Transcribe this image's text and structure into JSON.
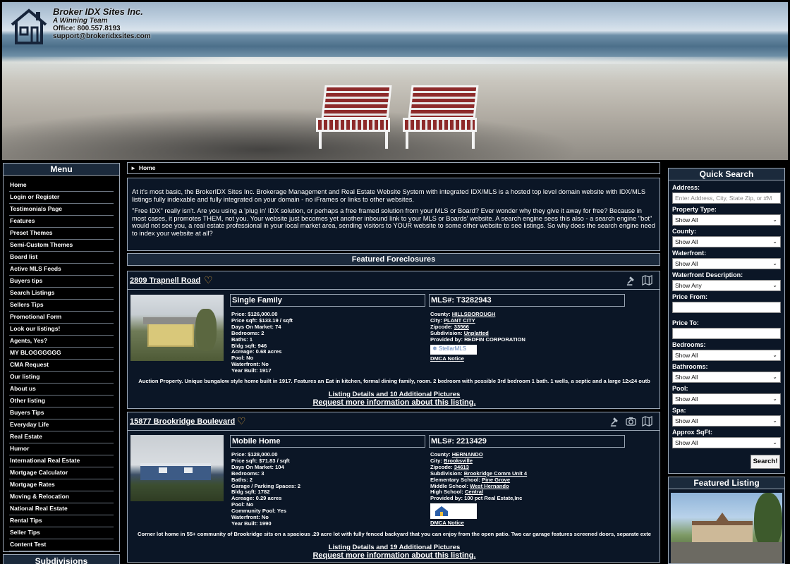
{
  "header": {
    "company_name": "Broker IDX Sites Inc.",
    "tagline": "A Winning Team",
    "office": "Office: 800.557.8193",
    "email": "support@brokeridxsites.com"
  },
  "menu": {
    "title": "Menu",
    "items": [
      "Home",
      "Login or Register",
      "Testimonials Page",
      "Features",
      "Preset Themes",
      "Semi-Custom Themes",
      "Board list",
      "Active MLS Feeds",
      "Buyers tips",
      "Search Listings",
      "Sellers Tips",
      "Promotional Form",
      "Look our listings!",
      "Agents, Yes?",
      "MY BLOGGGGGG",
      "CMA Request",
      "Our listing",
      "About us",
      "Other listing",
      "Buyers Tips",
      "Everyday Life",
      "Real Estate",
      "Humor",
      "International Real Estate",
      "Mortgage Calculator",
      "Mortgage Rates",
      "Moving & Relocation",
      "National Real Estate",
      "Rental Tips",
      "Seller Tips",
      "Content Test"
    ],
    "subdivisions_title": "Subdivisions"
  },
  "breadcrumb": {
    "home": "Home"
  },
  "intro": {
    "p1": "At it's most basic, the BrokerIDX Sites Inc. Brokerage Management and Real Estate Website System with integrated IDX/MLS is a hosted top level domain website with IDX/MLS listings fully indexable and fully integrated on your domain - no iFrames or links to other websites.",
    "p2": "\"Free IDX\" really isn't. Are you using a 'plug in' IDX solution, or perhaps a free framed solution from your MLS or Board? Ever wonder why they give it away for free? Because in most cases, it promotes THEM, not you. Your website just becomes yet another inbound link to your MLS or Boards' website. A search engine sees this also - a search engine \"bot\" would not see you, a real estate professional in your local market area, sending visitors to YOUR website to some other website to see listings. So why does the search engine need to index your website at all?"
  },
  "featured_foreclosures": {
    "title": "Featured Foreclosures"
  },
  "listings": [
    {
      "address": "2809 Trapnell Road",
      "type": "Single Family",
      "mls": "MLS#: T3282943",
      "facts": {
        "price": "Price: $126,000.00",
        "price_sqft": "Price sqft:  $133.19 / sqft",
        "dom": "Days On Market: 74",
        "bedrooms": "Bedrooms: 2",
        "baths": "Baths: 1",
        "bldg_sqft": "Bldg sqft: 946",
        "acreage": "Acreage: 0.68 acres",
        "pool": "Pool: No",
        "waterfront": "Waterfront: No",
        "year_built": "Year Built: 1917"
      },
      "geo": {
        "county_label": "County: ",
        "county": "HILLSBOROUGH",
        "city_label": "City: ",
        "city": "PLANT CITY",
        "zip_label": "Zipcode: ",
        "zip": "33566",
        "subdivision_label": "Subdivision: ",
        "subdivision": "Unplatted",
        "provided_by": "Provided by: REDFIN CORPORATION"
      },
      "mls_logo": "StellarMLS",
      "dmca": "DMCA Notice",
      "description": "Auction Property. Unique bungalow style home built in 1917. Features an Eat in kitchen, formal dining family, room. 2 bedroom with possible 3rd bedroom 1 bath. 1 wells, a septic and a large 12x24 outb",
      "details_link": "Listing Details and 10 Additional Pictures",
      "request_link": "Request more information about this listing."
    },
    {
      "address": "15877 Brookridge Boulevard",
      "type": "Mobile Home",
      "mls": "MLS#: 2213429",
      "facts": {
        "price": "Price: $128,000.00",
        "price_sqft": "Price sqft:  $71.83 / sqft",
        "dom": "Days On Market: 104",
        "bedrooms": "Bedrooms: 3",
        "baths": "Baths: 2",
        "garage": "Garage / Parking Spaces: 2",
        "bldg_sqft": "Bldg sqft: 1782",
        "acreage": "Acreage: 0.29 acres",
        "pool": "Pool: No",
        "community_pool": "Community Pool: Yes",
        "waterfront": "Waterfront: No",
        "year_built": "Year Built: 1990"
      },
      "geo": {
        "county_label": "County: ",
        "county": "HERNANDO",
        "city_label": "City: ",
        "city": "Brooksville",
        "zip_label": "Zipcode: ",
        "zip": "34613",
        "subdivision_label": "Subdivision: ",
        "subdivision": "Brookridge Comm Unit 4",
        "elem_label": "Elementary School: ",
        "elem": "Pine Grove",
        "middle_label": "Middle School: ",
        "middle": "West Hernando",
        "high_label": "High School: ",
        "high": "Central",
        "provided_by": "Provided by: 100 pct Real Estate,Inc"
      },
      "dmca": "DMCA Notice",
      "description": "Corner lot home in 55+ community of Brookridge sits on a spacious .29 acre lot with fully fenced backyard that you can enjoy from the open patio. Two car garage features screened doors, separate exte",
      "details_link": "Listing Details and 19 Additional Pictures",
      "request_link": "Request more information about this listing."
    }
  ],
  "quick_search": {
    "title": "Quick Search",
    "address_label": "Address:",
    "address_placeholder": "Enter Address, City, State Zip, or #M",
    "property_type_label": "Property Type:",
    "property_type_value": "Show All",
    "county_label": "County:",
    "county_value": "Show All",
    "waterfront_label": "Waterfront:",
    "waterfront_value": "Show All",
    "waterfront_desc_label": "Waterfront Description:",
    "waterfront_desc_value": "Show Any",
    "price_from_label": "Price From:",
    "price_to_label": "Price To:",
    "bedrooms_label": "Bedrooms:",
    "bedrooms_value": "Show All",
    "bathrooms_label": "Bathrooms:",
    "bathrooms_value": "Show All",
    "pool_label": "Pool:",
    "pool_value": "Show All",
    "spa_label": "Spa:",
    "spa_value": "Show All",
    "sqft_label": "Approx SqFt:",
    "sqft_value": "Show All",
    "search_button": "Search!"
  },
  "featured_listing": {
    "title": "Featured Listing"
  },
  "colors": {
    "panel_bg": "#0b1626",
    "title_bg": "#1b2a3c",
    "border": "#9aa6b4",
    "heart": "#f0b040"
  },
  "icons": [
    "house-logo-icon",
    "heart-icon",
    "auction-gavel-icon",
    "map-icon",
    "camera-icon",
    "chevron-down-icon",
    "breadcrumb-arrow-icon"
  ]
}
